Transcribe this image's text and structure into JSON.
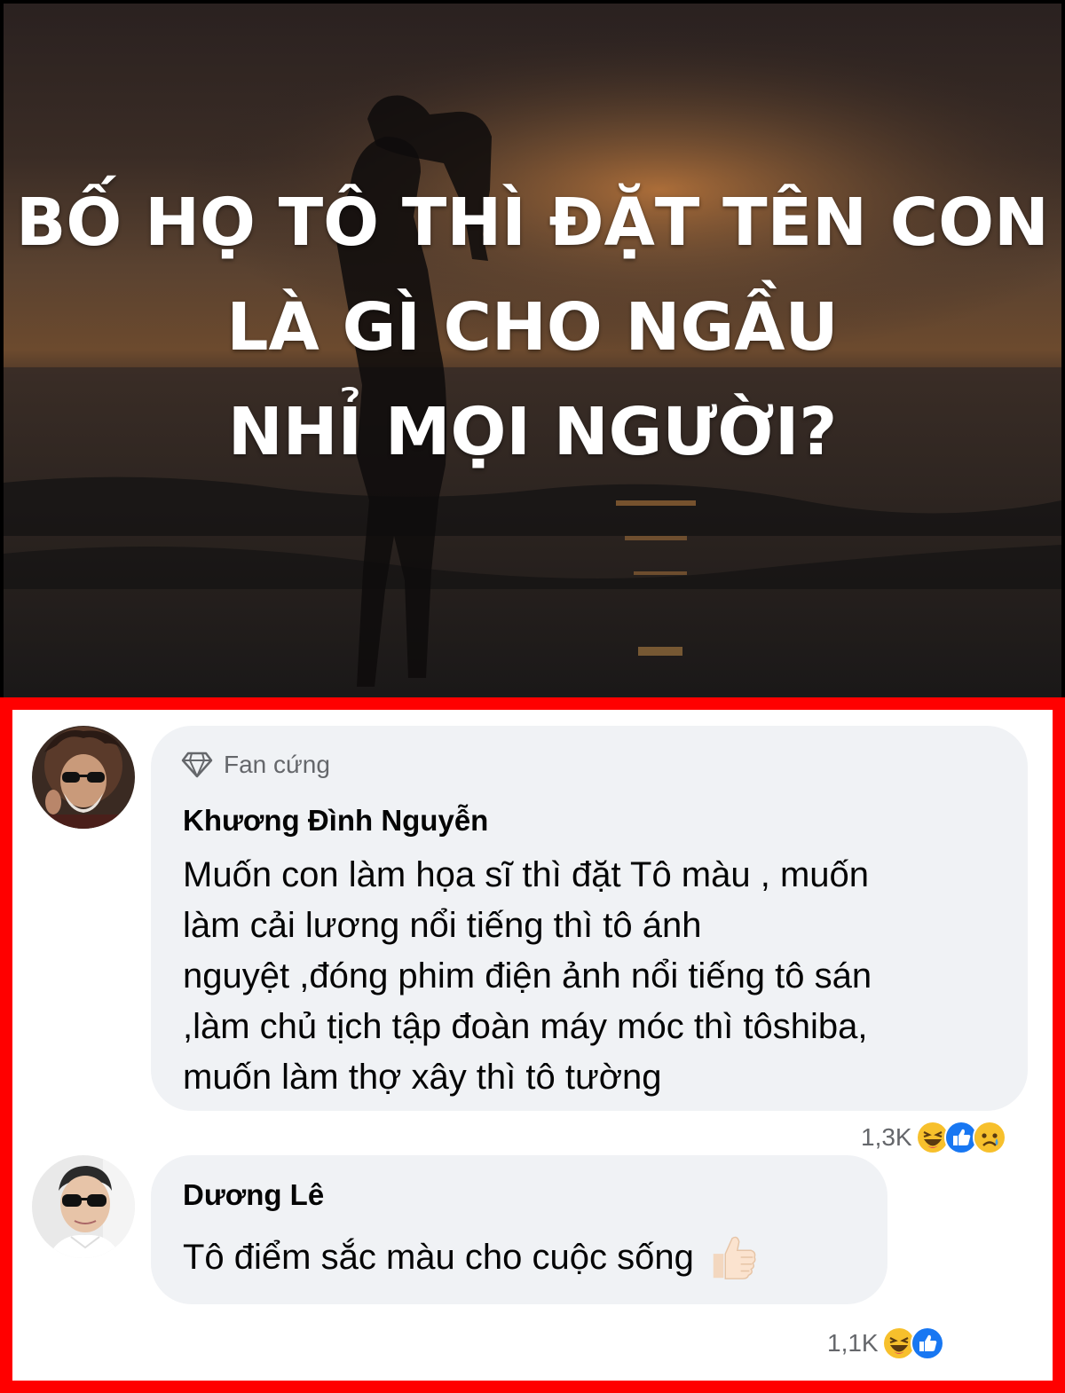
{
  "post": {
    "title_lines": [
      "BỐ HỌ TÔ THÌ ĐẶT TÊN CON",
      "LÀ GÌ CHO NGẦU",
      "NHỈ MỌI NGƯỜI?"
    ]
  },
  "comments": [
    {
      "badge": "Fan cứng",
      "badge_icon": "diamond-icon",
      "author": "Khương Đình Nguyễn",
      "text": "Muốn con làm họa sĩ thì đặt Tô màu , muốn\nlàm cải lương nổi tiếng thì tô ánh\nnguyệt ,đóng phim điện ảnh nổi tiếng tô sán\n,làm chủ tịch tập đoàn máy móc thì tôshiba,\nmuốn làm thợ xây thì tô tường",
      "reaction_count": "1,3K",
      "reactions": [
        "haha-icon",
        "like-icon",
        "sad-icon"
      ]
    },
    {
      "author": "Dương Lê",
      "text": "Tô điểm sắc màu cho cuộc sống",
      "text_emoji": "thumbs-up-icon",
      "reaction_count": "1,1K",
      "reactions": [
        "haha-icon",
        "like-icon"
      ]
    }
  ],
  "colors": {
    "frame_border": "#ff0000",
    "bubble_bg": "#f0f2f5",
    "meta_text": "#65676b",
    "like_blue": "#1877f2",
    "haha_yellow": "#f7c02c"
  }
}
